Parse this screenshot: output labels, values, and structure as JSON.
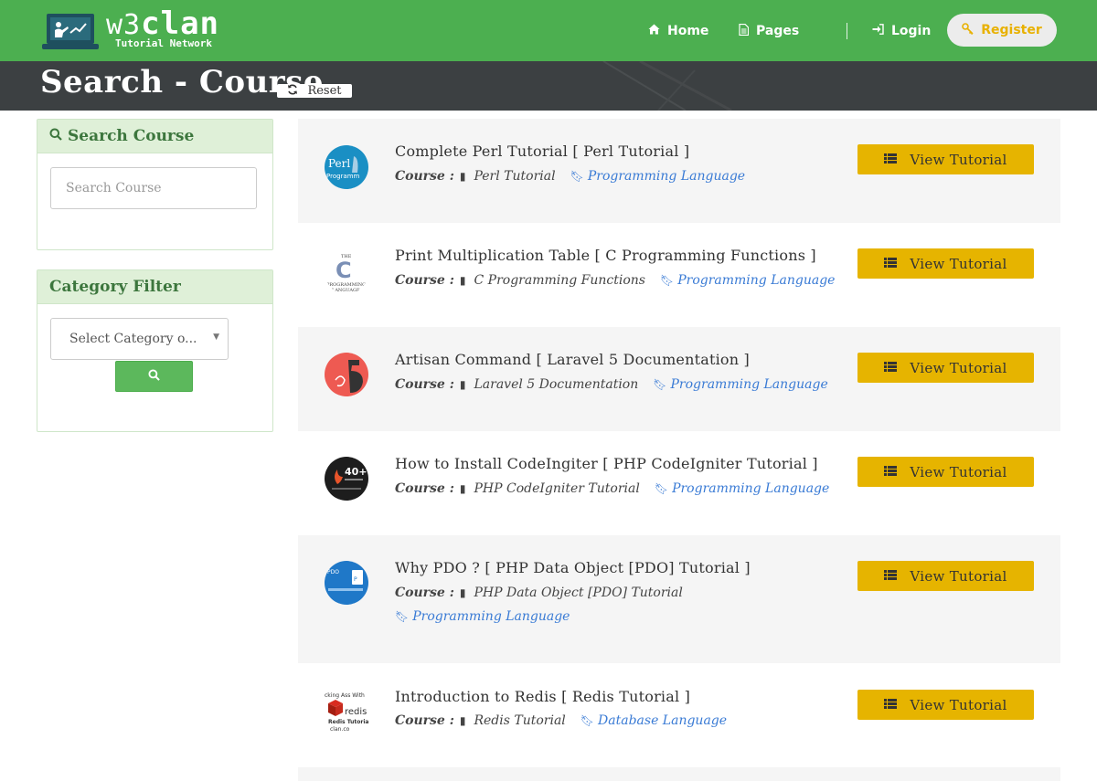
{
  "brand": {
    "name_light": "w3",
    "name_bold": "clan",
    "tagline": "Tutorial Network"
  },
  "nav": {
    "home": "Home",
    "pages": "Pages",
    "login": "Login",
    "register": "Register"
  },
  "header": {
    "title": "Search - Course",
    "reset_label": "Reset"
  },
  "search_panel": {
    "title": "Search Course",
    "placeholder": "Search Course",
    "value": ""
  },
  "category_panel": {
    "title": "Category Filter",
    "selected": "Select Category o..."
  },
  "colors": {
    "brand_green": "#4caf50",
    "button_yellow": "#e6b400",
    "link_blue": "#3a7bd5",
    "title_bar": "#3c4042"
  },
  "course_label": "Course :",
  "view_label": "View Tutorial",
  "courses": [
    {
      "title": "Complete Perl Tutorial [ Perl Tutorial ]",
      "course": "Perl Tutorial",
      "category": "Programming Language",
      "thumb": "perl-programming"
    },
    {
      "title": "Print Multiplication Table [ C Programming Functions ]",
      "course": "C Programming Functions",
      "category": "Programming Language",
      "thumb": "c-programming"
    },
    {
      "title": "Artisan Command [ Laravel 5 Documentation ]",
      "course": "Laravel 5 Documentation",
      "category": "Programming Language",
      "thumb": "laravel-5"
    },
    {
      "title": "How to Install CodeIngiter [ PHP CodeIgniter Tutorial ]",
      "course": "PHP CodeIgniter Tutorial",
      "category": "Programming Language",
      "thumb": "codeigniter-40plus"
    },
    {
      "title": "Why PDO ? [ PHP Data Object [PDO] Tutorial ]",
      "course": "PHP Data Object [PDO] Tutorial",
      "category": "Programming Language",
      "thumb": "php-pdo"
    },
    {
      "title": "Introduction to Redis [ Redis Tutorial ]",
      "course": "Redis Tutorial",
      "category": "Database Language",
      "thumb": "redis"
    }
  ]
}
